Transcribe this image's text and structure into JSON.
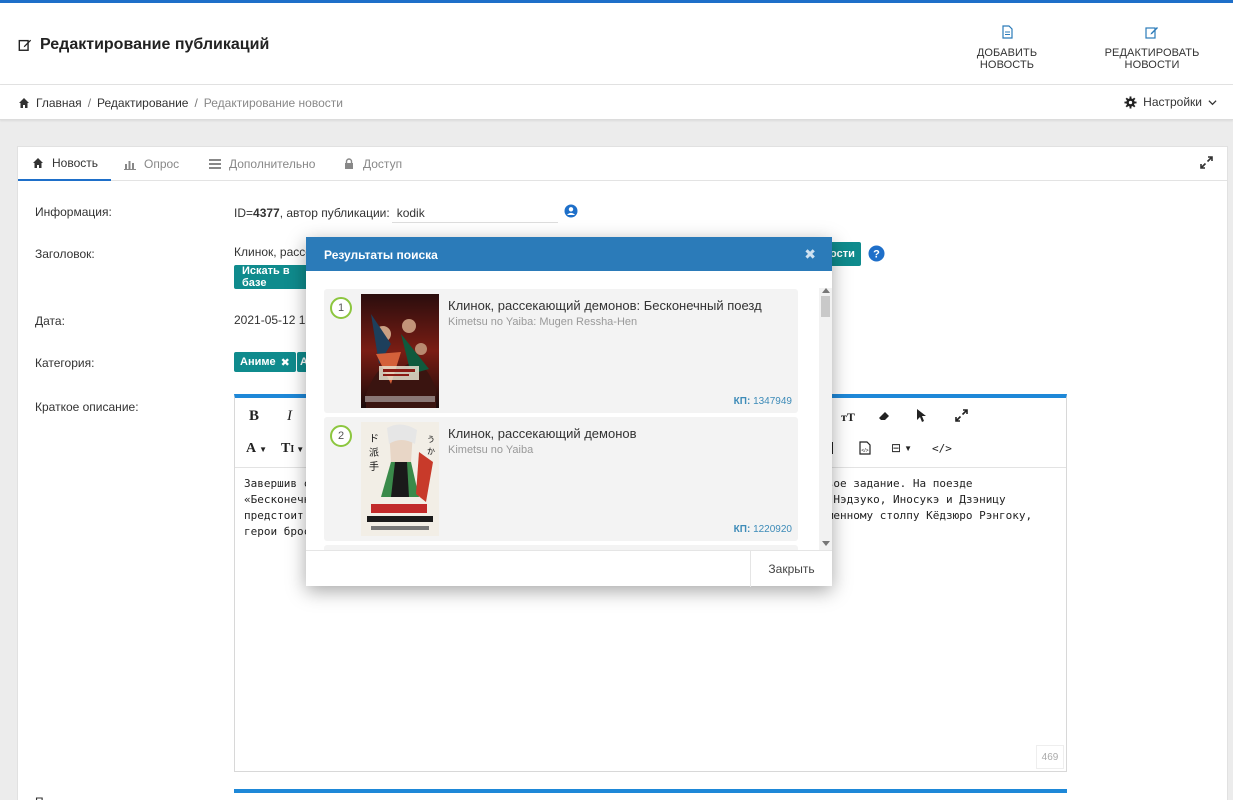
{
  "header": {
    "title": "Редактирование публикаций",
    "actions": [
      {
        "label": "ДОБАВИТЬ НОВОСТЬ",
        "icon": "file-icon"
      },
      {
        "label": "РЕДАКТИРОВАТЬ НОВОСТИ",
        "icon": "edit-icon"
      }
    ]
  },
  "breadcrumb": {
    "items": [
      "Главная",
      "Редактирование"
    ],
    "current": "Редактирование новости",
    "settings_label": "Настройки"
  },
  "tabs": [
    {
      "label": "Новость",
      "icon": "home-icon",
      "active": true
    },
    {
      "label": "Опрос",
      "icon": "bar-chart-icon",
      "active": false
    },
    {
      "label": "Дополнительно",
      "icon": "list-icon",
      "active": false
    },
    {
      "label": "Доступ",
      "icon": "lock-icon",
      "active": false
    }
  ],
  "form": {
    "info_label": "Информация:",
    "id_prefix": "ID=",
    "id_value": "4377",
    "author_prefix": ", автор публикации:",
    "author_value": "kodik",
    "title_label": "Заголовок:",
    "title_value": "Клинок, рассе",
    "search_db_button": "Искать в базе",
    "news_button_tail": "ости",
    "date_label": "Дата:",
    "date_value": "2021-05-12 15",
    "category_label": "Категория:",
    "category_tags": [
      "Аниме",
      "А"
    ],
    "short_desc_label": "Краткое описание:",
    "next_label": "П"
  },
  "editor": {
    "content_lines": [
      "Завершив с                                                                         ть новое задание. На поезде",
      "«Бесконечн                                                                          иро, Нэдзуко, Иносукэ и Дзэницу",
      "предстоит с                                                                          пламенному столпу Кёдзюро Рэнгоку,",
      "герои броса"
    ],
    "char_count": "469"
  },
  "modal": {
    "title": "Результаты поиска",
    "close_label": "Закрыть",
    "results": [
      {
        "num": "1",
        "title": "Клинок, рассекающий демонов: Бесконечный поезд",
        "original": "Kimetsu no Yaiba: Mugen Ressha-Hen",
        "kp_label": "КП:",
        "kp_value": "1347949"
      },
      {
        "num": "2",
        "title": "Клинок, рассекающий демонов",
        "original": "Kimetsu no Yaiba",
        "kp_label": "КП:",
        "kp_value": "1220920"
      }
    ]
  },
  "colors": {
    "accent": "#1e6fc9",
    "teal": "#0f8b8d",
    "modal_header": "#2b7bb9",
    "badge_ring": "#8cc63f"
  }
}
